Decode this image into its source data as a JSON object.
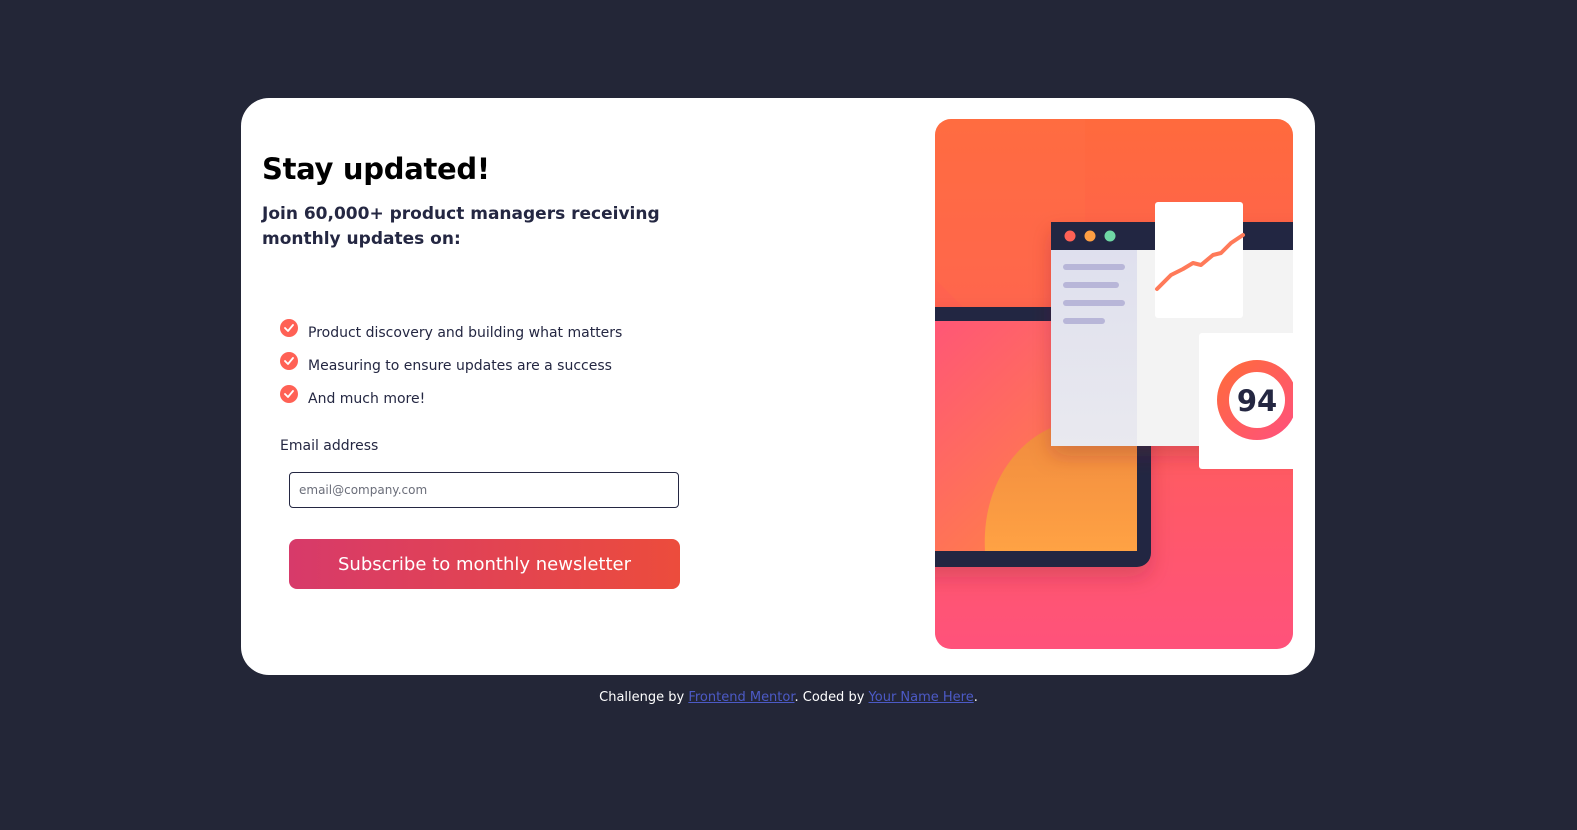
{
  "card": {
    "title": "Stay updated!",
    "subtitle": "Join 60,000+ product managers receiving monthly updates on:",
    "features": [
      "Product discovery and building what matters",
      "Measuring to ensure updates are a success",
      "And much more!"
    ],
    "email_label": "Email address",
    "email_placeholder": "email@company.com",
    "email_value": "",
    "subscribe_label": "Subscribe to monthly newsletter"
  },
  "illustration": {
    "score": "94",
    "colors": {
      "gradient_top": "#ff6a3d",
      "gradient_bottom": "#ff527b",
      "accent_tomato": "#ff6155",
      "navy": "#242742",
      "dot_red": "#ff6155",
      "dot_orange": "#ff9f43",
      "dot_green": "#6fd8a5"
    }
  },
  "footer": {
    "prefix": "Challenge by ",
    "link1": "Frontend Mentor",
    "middle": ". Coded by ",
    "link2": "Your Name Here",
    "suffix": "."
  },
  "icons": {
    "feature_bullet": "check-icon"
  },
  "colors": {
    "page_background": "#232637",
    "card_background": "#ffffff",
    "button_gradient_start": "#d73a6a",
    "button_gradient_end": "#ec4c3c",
    "link": "#4c5ac6"
  }
}
